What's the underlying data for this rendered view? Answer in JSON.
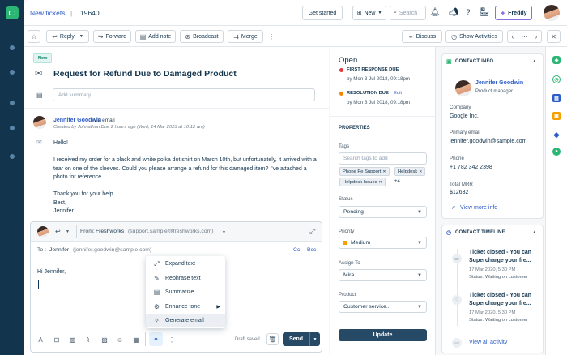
{
  "header": {
    "breadcrumb_link": "New tickets",
    "breadcrumb_sep": "|",
    "ticket_id": "19640",
    "get_started": "Get started",
    "new_label": "New",
    "search_placeholder": "Search",
    "freddy_label": "Freddy"
  },
  "toolbar": {
    "reply": "Reply",
    "forward": "Forward",
    "add_note": "Add note",
    "broadcast": "Broadcast",
    "merge": "Merge",
    "discuss": "Discuss",
    "show_activities": "Show Activities"
  },
  "ticket": {
    "badge": "New",
    "subject": "Request for Refund Due to Damaged Product",
    "summary_placeholder": "Add summary",
    "message": {
      "author": "Jennifer Goodwin",
      "via": "via email",
      "meta": "Created by Johnathan Doe  2 hours ago (Wed, 14 Mar 2023 at 10:12 am)",
      "body": [
        "Hello!",
        "I received my order for a black and white polka dot shirt on March 10th, but unfortunately, it arrived with a tear on one of the sleeves. Could you please arrange a refund for this damaged item? I've attached a photo for reference.",
        "Thank you for your help.",
        "Best,",
        "Jennifer"
      ]
    }
  },
  "reply": {
    "from_label": "From:",
    "from_value": "Freshworks",
    "from_email": "(support.sample@freshworks.com)",
    "to_label": "To :",
    "to_name": "Jennifer",
    "to_email": "(jennifer.goodwin@sample.com)",
    "cc": "Cc",
    "bcc": "Bcc",
    "body": "Hi Jennifer,",
    "draft_status": "Draft saved",
    "send": "Send"
  },
  "ai_menu": [
    {
      "label": "Expand text",
      "icon": "expand-icon"
    },
    {
      "label": "Rephrase text",
      "icon": "pencil-icon"
    },
    {
      "label": "Summarize",
      "icon": "document-icon"
    },
    {
      "label": "Enhance tone",
      "icon": "sliders-icon"
    },
    {
      "label": "Generate email",
      "icon": "sparkle-icon"
    }
  ],
  "properties": {
    "status_title": "Open",
    "first_response_label": "FIRST RESPONSE DUE",
    "first_response_value": "by Mon 3 Jul 2018, 09:18pm",
    "resolution_label": "RESOLUTION DUE",
    "resolution_edit": "Edit",
    "resolution_value": "by Mon 3 Jul 2018, 09:18pm",
    "section_title": "PROPERTIES",
    "tags_label": "Tags",
    "tags_placeholder": "Search tags to add",
    "tags": [
      "Phone Pe Support",
      "Helpdesk",
      "Helpdesk Issues"
    ],
    "tags_more": "+4",
    "status_label": "Status",
    "status_value": "Pending",
    "priority_label": "Priority",
    "priority_value": "Medium",
    "priority_color": "#f4a100",
    "assign_label": "Assign To",
    "assign_value": "Mira",
    "product_label": "Product",
    "product_value": "Customer service...",
    "update": "Update"
  },
  "contact": {
    "header": "CONTACT INFO",
    "name": "Jennifer Goodwin",
    "title": "Product manager",
    "company_label": "Company",
    "company_value": "Google Inc.",
    "email_label": "Primary email",
    "email_value": "jennifer.goodwin@sample.com",
    "phone_label": "Phone",
    "phone_value": "+1 782 342 2398",
    "mrr_label": "Total MRR",
    "mrr_value": "$12632",
    "view_more": "View more info"
  },
  "timeline": {
    "header": "CONTACT TIMELINE",
    "items": [
      {
        "title1": "Ticket closed - You can",
        "title2": "Supercharge your fre...",
        "date": "17 Mar 2020, 5:30 PM",
        "status_label": "Status:",
        "status_value": "Waiting on customer"
      },
      {
        "title1": "Ticket closed - You can",
        "title2": "Supercharge your fre...",
        "date": "17 Mar 2020, 5:30 PM",
        "status_label": "Status:",
        "status_value": "Waiting on customer"
      }
    ],
    "view_all": "View all activity"
  },
  "colors": {
    "brand_dark": "#12344d",
    "link": "#2c5cc5",
    "button_primary": "#264966",
    "due_red": "#e43538",
    "due_orange": "#f58500"
  }
}
